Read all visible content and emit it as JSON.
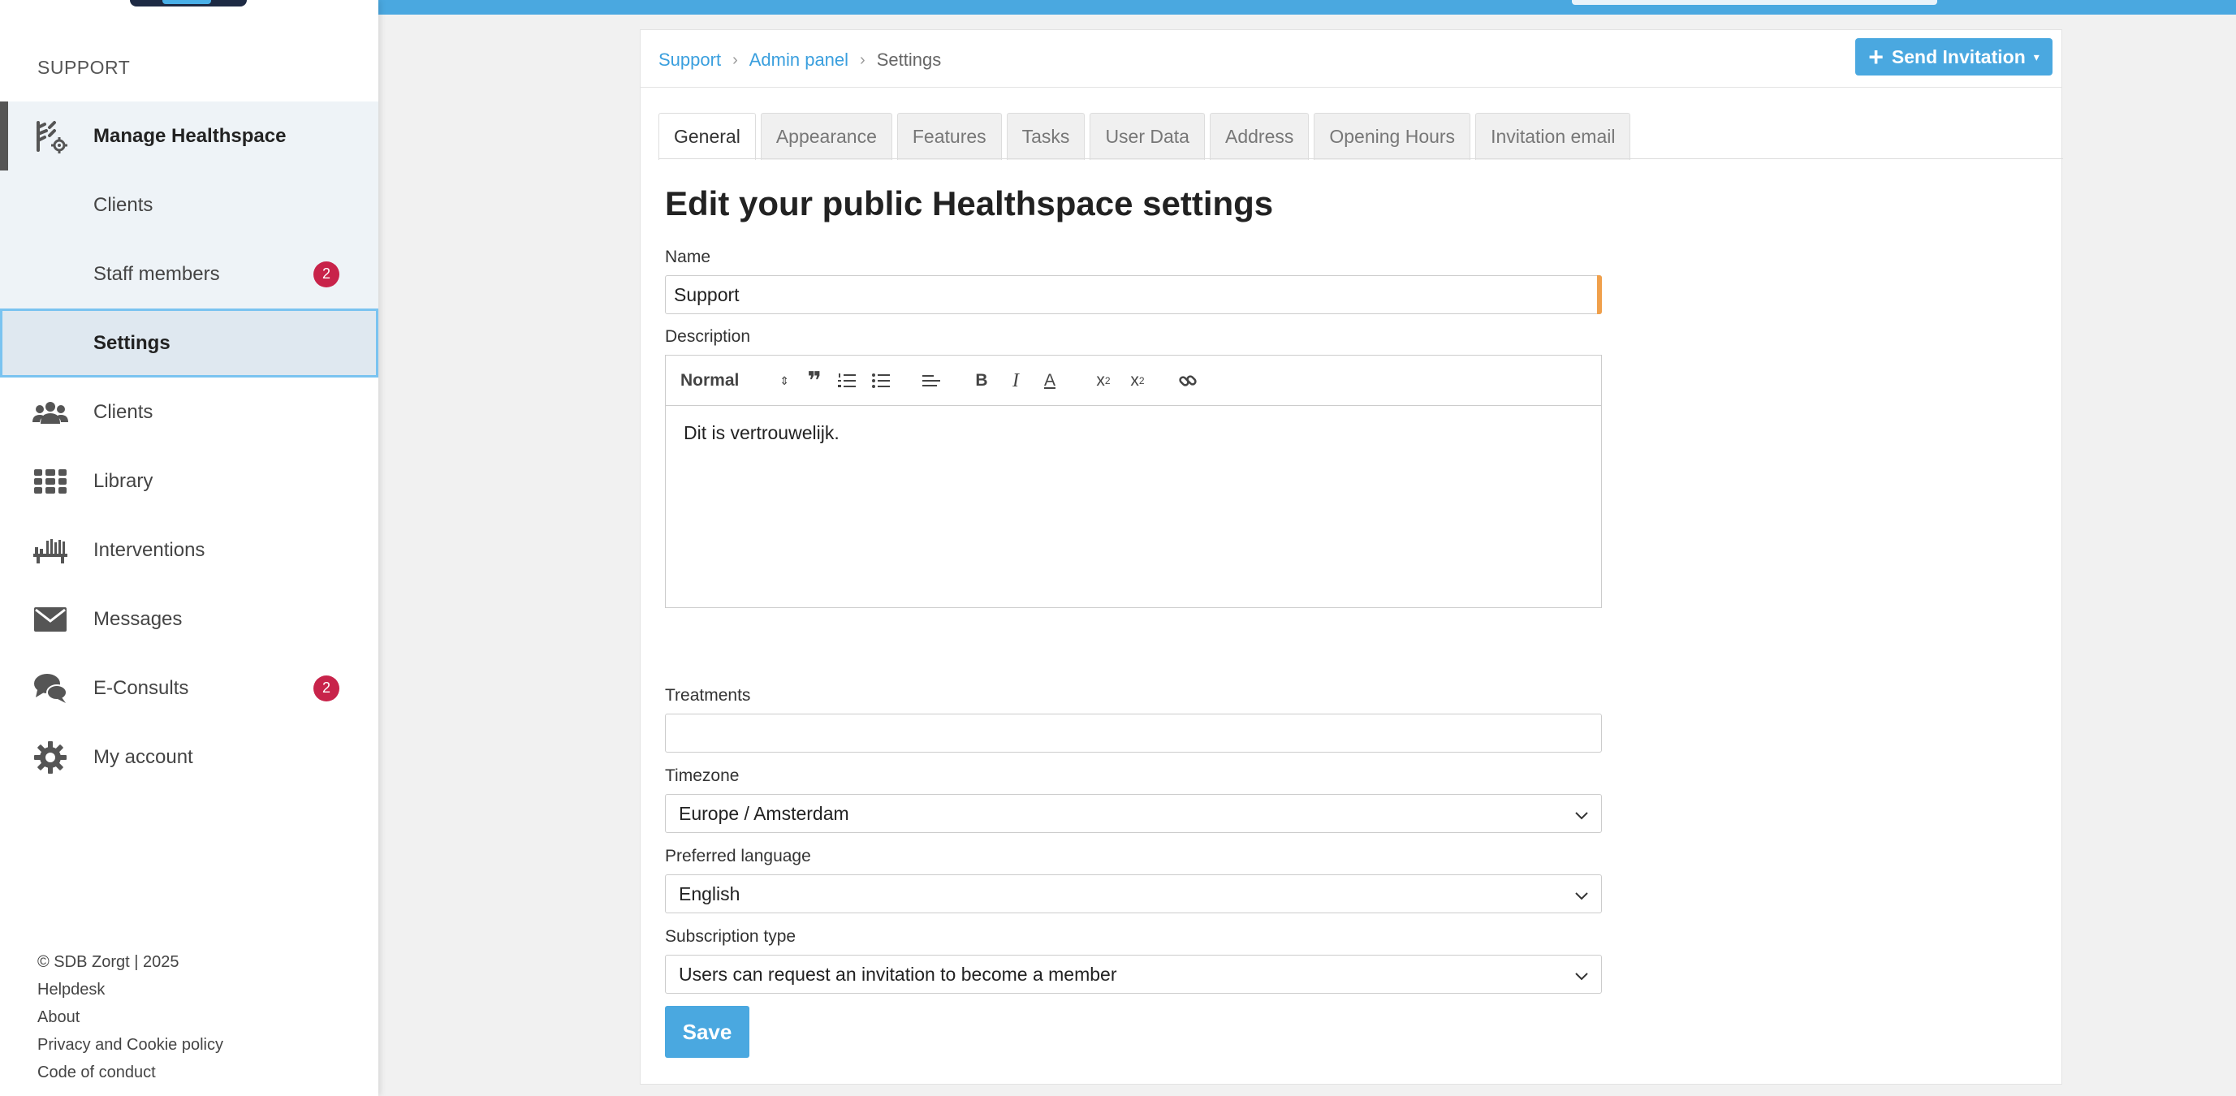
{
  "sidebar": {
    "heading": "SUPPORT",
    "items": [
      {
        "label": "Manage Healthspace",
        "icon": "manage-healthspace-icon"
      },
      {
        "label": "Clients"
      },
      {
        "label": "Staff members",
        "badge": "2"
      },
      {
        "label": "Settings"
      },
      {
        "label": "Clients",
        "icon": "clients-group-icon"
      },
      {
        "label": "Library",
        "icon": "library-grid-icon"
      },
      {
        "label": "Interventions",
        "icon": "interventions-icon"
      },
      {
        "label": "Messages",
        "icon": "envelope-icon"
      },
      {
        "label": "E-Consults",
        "icon": "chat-bubbles-icon",
        "badge": "2"
      },
      {
        "label": "My account",
        "icon": "gear-icon"
      }
    ],
    "footer": {
      "copyright": "© SDB Zorgt | 2025",
      "links": [
        "Helpdesk",
        "About",
        "Privacy and Cookie policy",
        "Code of conduct"
      ]
    }
  },
  "breadcrumb": {
    "items": [
      "Support",
      "Admin panel"
    ],
    "current": "Settings"
  },
  "header": {
    "send_invitation": "Send Invitation"
  },
  "tabs": [
    "General",
    "Appearance",
    "Features",
    "Tasks",
    "User Data",
    "Address",
    "Opening Hours",
    "Invitation email"
  ],
  "form": {
    "title": "Edit your public Healthspace settings",
    "name_label": "Name",
    "name_value": "Support",
    "description_label": "Description",
    "editor_format": "Normal",
    "description_value": "Dit is vertrouwelijk.",
    "treatments_label": "Treatments",
    "treatments_value": "",
    "timezone_label": "Timezone",
    "timezone_value": "Europe / Amsterdam",
    "language_label": "Preferred language",
    "language_value": "English",
    "subscription_label": "Subscription type",
    "subscription_value": "Users can request an invitation to become a member",
    "save_label": "Save"
  },
  "colors": {
    "accent": "#4aa8e0",
    "badge": "#c8234a",
    "name_accent": "#f0a04b"
  }
}
